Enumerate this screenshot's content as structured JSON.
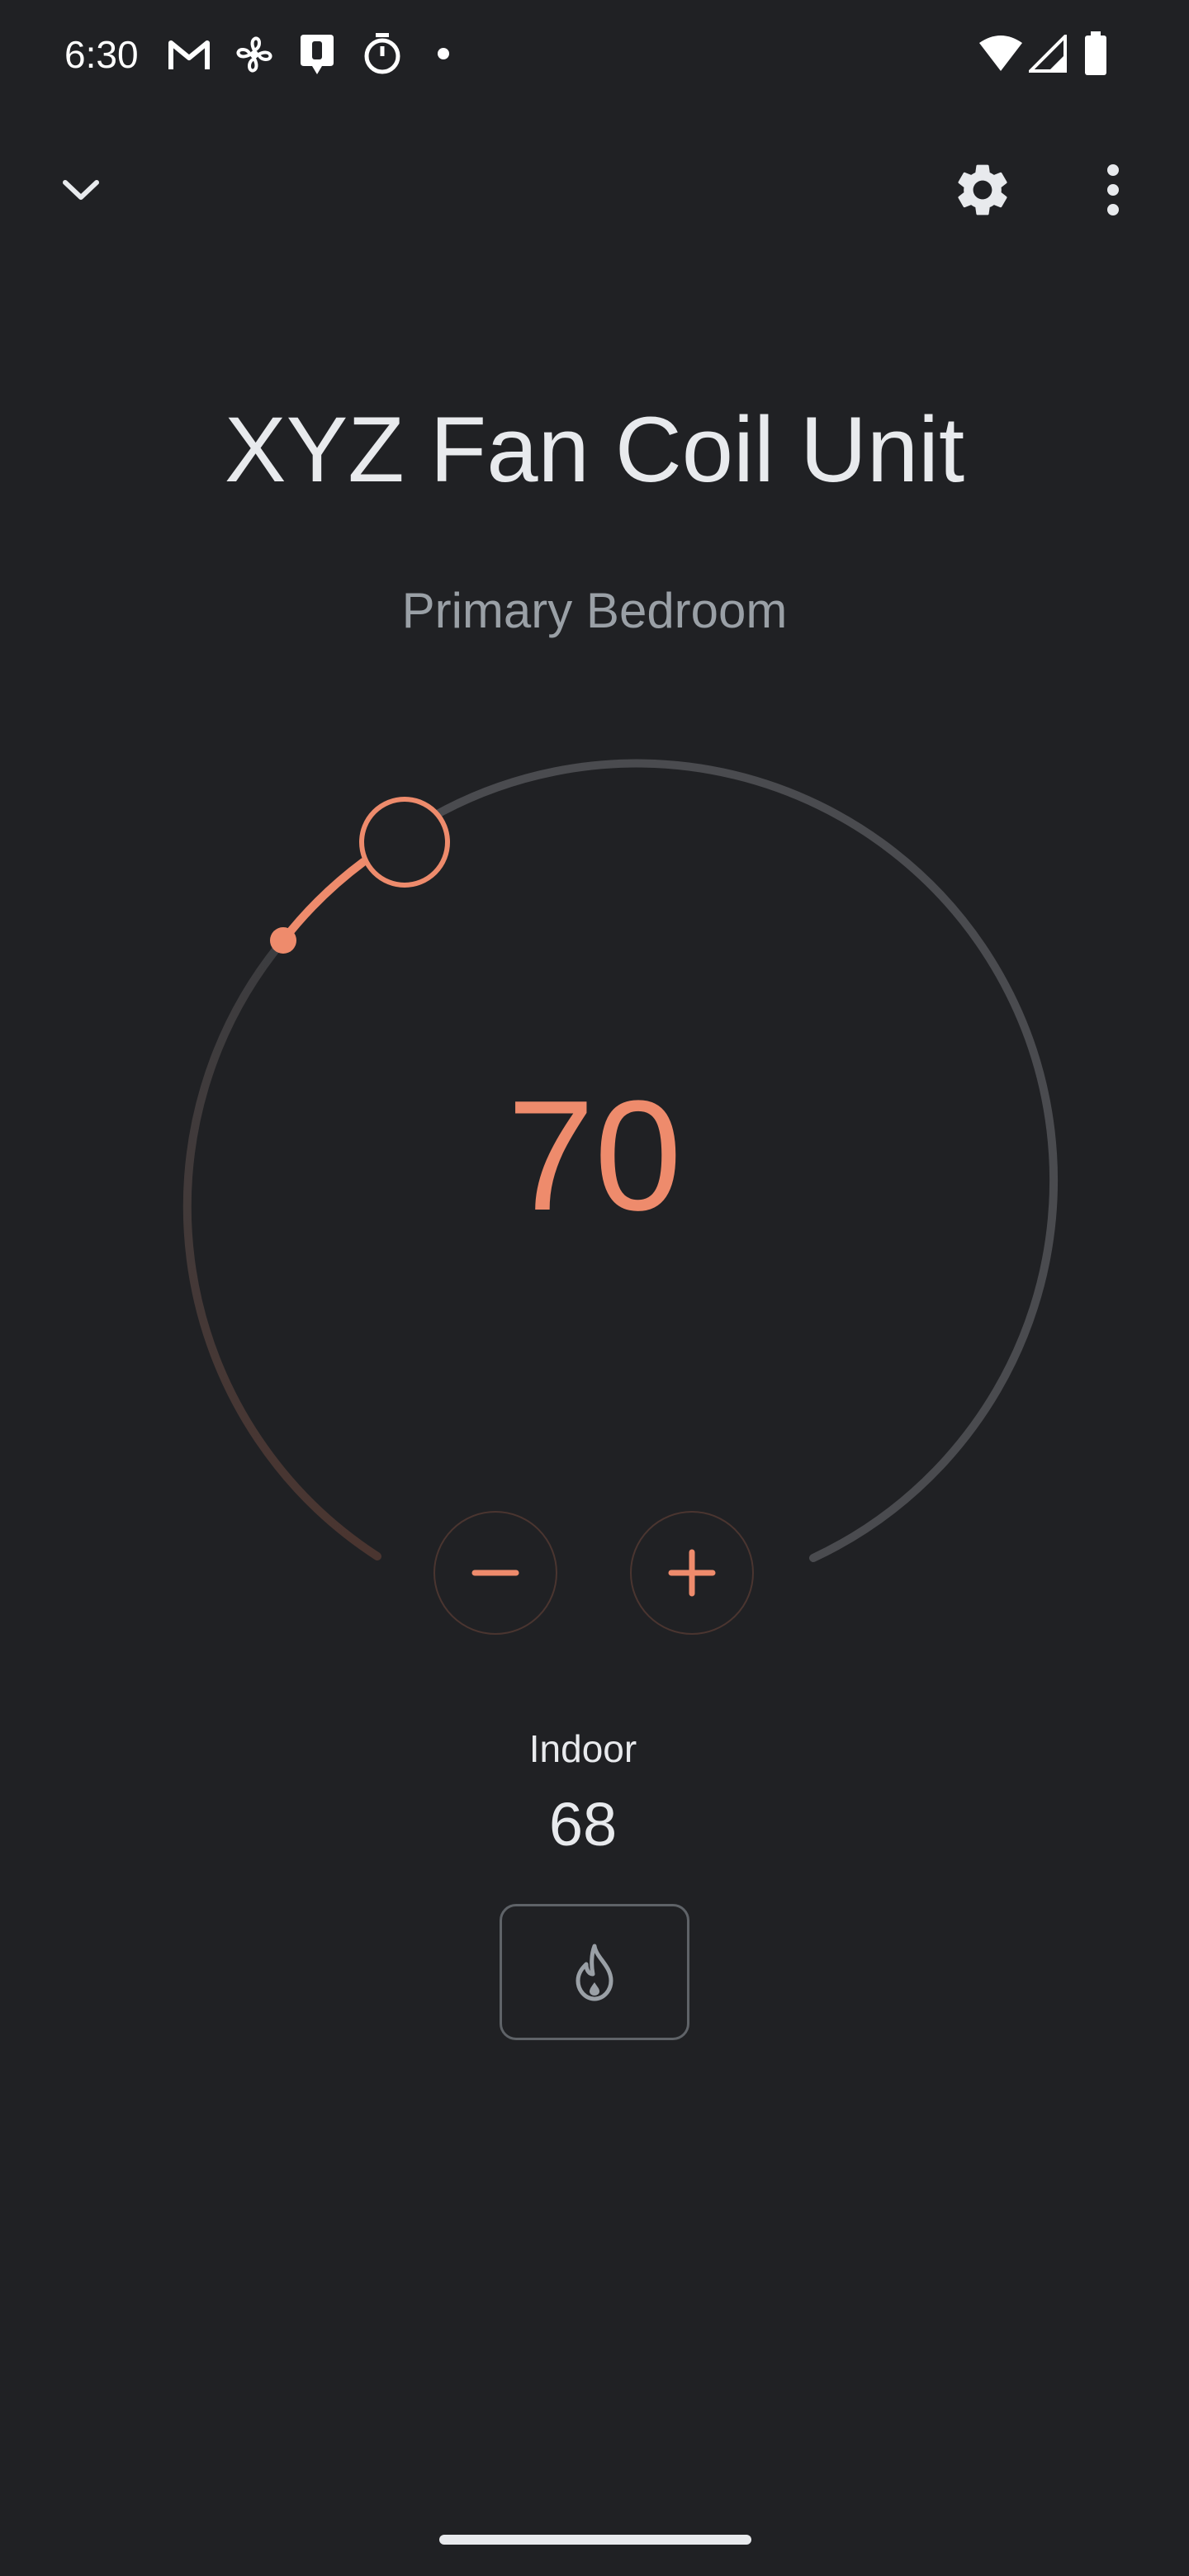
{
  "status_bar": {
    "time": "6:30",
    "left_icons": [
      "gmail-icon",
      "fan-icon",
      "assistant-icon",
      "timer-icon",
      "dot-icon"
    ],
    "right_icons": [
      "wifi-icon",
      "signal-icon",
      "battery-icon"
    ]
  },
  "app_bar": {
    "collapse_icon": "chevron-down-icon",
    "settings_icon": "gear-icon",
    "more_icon": "more-vert-icon"
  },
  "device": {
    "name": "XYZ Fan Coil Unit",
    "room": "Primary Bedroom"
  },
  "thermostat": {
    "setpoint": "70",
    "decrease_symbol": "−",
    "increase_symbol": "+",
    "indoor_label": "Indoor",
    "indoor_value": "68",
    "mode_icon": "flame-icon"
  },
  "colors": {
    "background": "#202124",
    "accent": "#ee8b6c",
    "track": "#4a4b4f",
    "text_primary": "#e8eaed",
    "text_secondary": "#9aa0a6"
  }
}
